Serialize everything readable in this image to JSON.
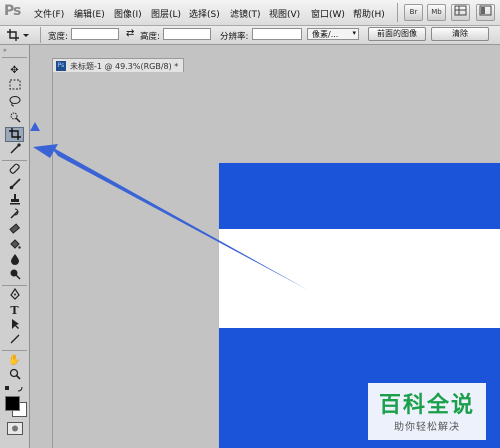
{
  "app": {
    "logo": "Ps"
  },
  "menu": [
    {
      "id": "file",
      "label": "文件(F)"
    },
    {
      "id": "edit",
      "label": "编辑(E)"
    },
    {
      "id": "image",
      "label": "图像(I)"
    },
    {
      "id": "layer",
      "label": "图层(L)"
    },
    {
      "id": "select",
      "label": "选择(S)"
    },
    {
      "id": "filter",
      "label": "滤镜(T)"
    },
    {
      "id": "view",
      "label": "视图(V)"
    },
    {
      "id": "window",
      "label": "窗口(W)"
    },
    {
      "id": "help",
      "label": "帮助(H)"
    }
  ],
  "toolbar_buttons": {
    "br": "Br",
    "mb": "Mb"
  },
  "options": {
    "width_label": "宽度:",
    "swap_symbol": "⇄",
    "height_label": "高度:",
    "resolution_label": "分辨率:",
    "unit_value": "像素/...",
    "front_image_button": "前面的图像",
    "clear_button": "清除"
  },
  "document": {
    "tab_title": "未标题-1 @ 49.3%(RGB/8) *"
  },
  "image_bands": [
    {
      "color": "#1b54d9",
      "fraction": 0.23
    },
    {
      "color": "#ffffff",
      "fraction": 0.35
    },
    {
      "color": "#1b54d9",
      "fraction": 0.42
    }
  ],
  "annotation": {
    "arrow_color": "#3a63d6"
  },
  "watermark": {
    "title": "百科全说",
    "subtitle": "助你轻松解决"
  }
}
